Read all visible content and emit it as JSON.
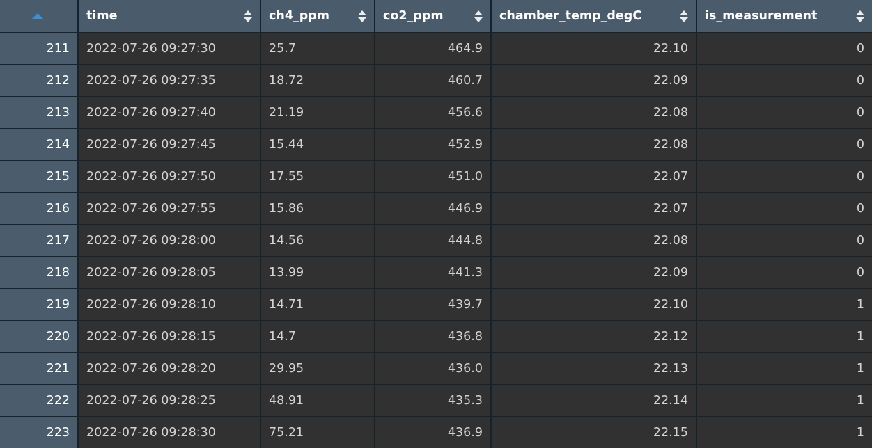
{
  "table": {
    "sort": {
      "column": "index",
      "direction": "ascending",
      "indicator_color": "#3d8fd8"
    },
    "index_header_label": "",
    "columns": [
      {
        "key": "index",
        "label": "",
        "align": "right",
        "sortable": true,
        "sort_icon": "sort-ascending-icon"
      },
      {
        "key": "time",
        "label": "time",
        "align": "left",
        "sortable": true,
        "sort_icon": "sort-updown-icon"
      },
      {
        "key": "ch4_ppm",
        "label": "ch4_ppm",
        "align": "left",
        "sortable": true,
        "sort_icon": "sort-updown-icon"
      },
      {
        "key": "co2_ppm",
        "label": "co2_ppm",
        "align": "right",
        "sortable": true,
        "sort_icon": "sort-updown-icon"
      },
      {
        "key": "chamber_temp_degC",
        "label": "chamber_temp_degC",
        "align": "right",
        "sortable": true,
        "sort_icon": "sort-updown-icon"
      },
      {
        "key": "is_measurement",
        "label": "is_measurement",
        "align": "right",
        "sortable": true,
        "sort_icon": "sort-updown-icon"
      }
    ],
    "rows": [
      {
        "index": "211",
        "time": "2022-07-26 09:27:30",
        "ch4_ppm": "25.7",
        "co2_ppm": "464.9",
        "chamber_temp_degC": "22.10",
        "is_measurement": "0"
      },
      {
        "index": "212",
        "time": "2022-07-26 09:27:35",
        "ch4_ppm": "18.72",
        "co2_ppm": "460.7",
        "chamber_temp_degC": "22.09",
        "is_measurement": "0"
      },
      {
        "index": "213",
        "time": "2022-07-26 09:27:40",
        "ch4_ppm": "21.19",
        "co2_ppm": "456.6",
        "chamber_temp_degC": "22.08",
        "is_measurement": "0"
      },
      {
        "index": "214",
        "time": "2022-07-26 09:27:45",
        "ch4_ppm": "15.44",
        "co2_ppm": "452.9",
        "chamber_temp_degC": "22.08",
        "is_measurement": "0"
      },
      {
        "index": "215",
        "time": "2022-07-26 09:27:50",
        "ch4_ppm": "17.55",
        "co2_ppm": "451.0",
        "chamber_temp_degC": "22.07",
        "is_measurement": "0"
      },
      {
        "index": "216",
        "time": "2022-07-26 09:27:55",
        "ch4_ppm": "15.86",
        "co2_ppm": "446.9",
        "chamber_temp_degC": "22.07",
        "is_measurement": "0"
      },
      {
        "index": "217",
        "time": "2022-07-26 09:28:00",
        "ch4_ppm": "14.56",
        "co2_ppm": "444.8",
        "chamber_temp_degC": "22.08",
        "is_measurement": "0"
      },
      {
        "index": "218",
        "time": "2022-07-26 09:28:05",
        "ch4_ppm": "13.99",
        "co2_ppm": "441.3",
        "chamber_temp_degC": "22.09",
        "is_measurement": "0"
      },
      {
        "index": "219",
        "time": "2022-07-26 09:28:10",
        "ch4_ppm": "14.71",
        "co2_ppm": "439.7",
        "chamber_temp_degC": "22.10",
        "is_measurement": "1"
      },
      {
        "index": "220",
        "time": "2022-07-26 09:28:15",
        "ch4_ppm": "14.7",
        "co2_ppm": "436.8",
        "chamber_temp_degC": "22.12",
        "is_measurement": "1"
      },
      {
        "index": "221",
        "time": "2022-07-26 09:28:20",
        "ch4_ppm": "29.95",
        "co2_ppm": "436.0",
        "chamber_temp_degC": "22.13",
        "is_measurement": "1"
      },
      {
        "index": "222",
        "time": "2022-07-26 09:28:25",
        "ch4_ppm": "48.91",
        "co2_ppm": "435.3",
        "chamber_temp_degC": "22.14",
        "is_measurement": "1"
      },
      {
        "index": "223",
        "time": "2022-07-26 09:28:30",
        "ch4_ppm": "75.21",
        "co2_ppm": "436.9",
        "chamber_temp_degC": "22.15",
        "is_measurement": "1"
      }
    ]
  },
  "theme": {
    "header_bg": "#4a5b6b",
    "index_bg": "#4b5c6c",
    "cell_bg": "#313131",
    "grid_line": "#16222e",
    "text": "#d2d2d2",
    "header_text": "#ffffff",
    "accent": "#3d8fd8"
  }
}
